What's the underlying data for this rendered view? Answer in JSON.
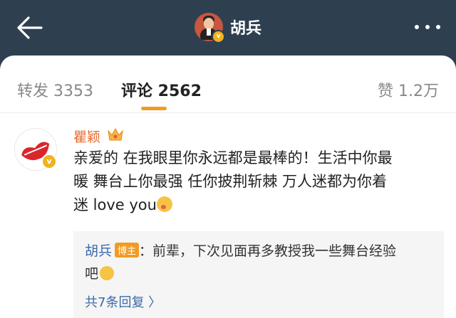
{
  "header": {
    "title": "胡兵",
    "back_icon": "arrow-left-icon",
    "more_icon": "more-dots-icon",
    "verified_icon": "verified-v-icon"
  },
  "tabs": {
    "repost": "转发 3353",
    "comments": "评论 2562",
    "likes": "赞 1.2万"
  },
  "comment": {
    "author": "瞿颖",
    "badge_icon": "crown-icon",
    "line1": "亲爱的 在我眼里你永远都是最棒的！生活中你最",
    "line2": "暖 舞台上你最强 任你披荆斩棘 万人迷都为你着",
    "line3": "迷 love you",
    "emoji_icon": "blush-emoji-icon"
  },
  "reply": {
    "author": "胡兵",
    "tag": "博主",
    "text1": "：前辈，下次见面再多教授我一些舞台经验",
    "text2": "吧",
    "emoji_icon": "smile-emoji-icon",
    "more": "共7条回复 〉"
  },
  "colors": {
    "header_bg": "#2e4050",
    "accent": "#f29b24",
    "name_orange": "#e86b2d",
    "link_blue": "#3b6aa8"
  }
}
